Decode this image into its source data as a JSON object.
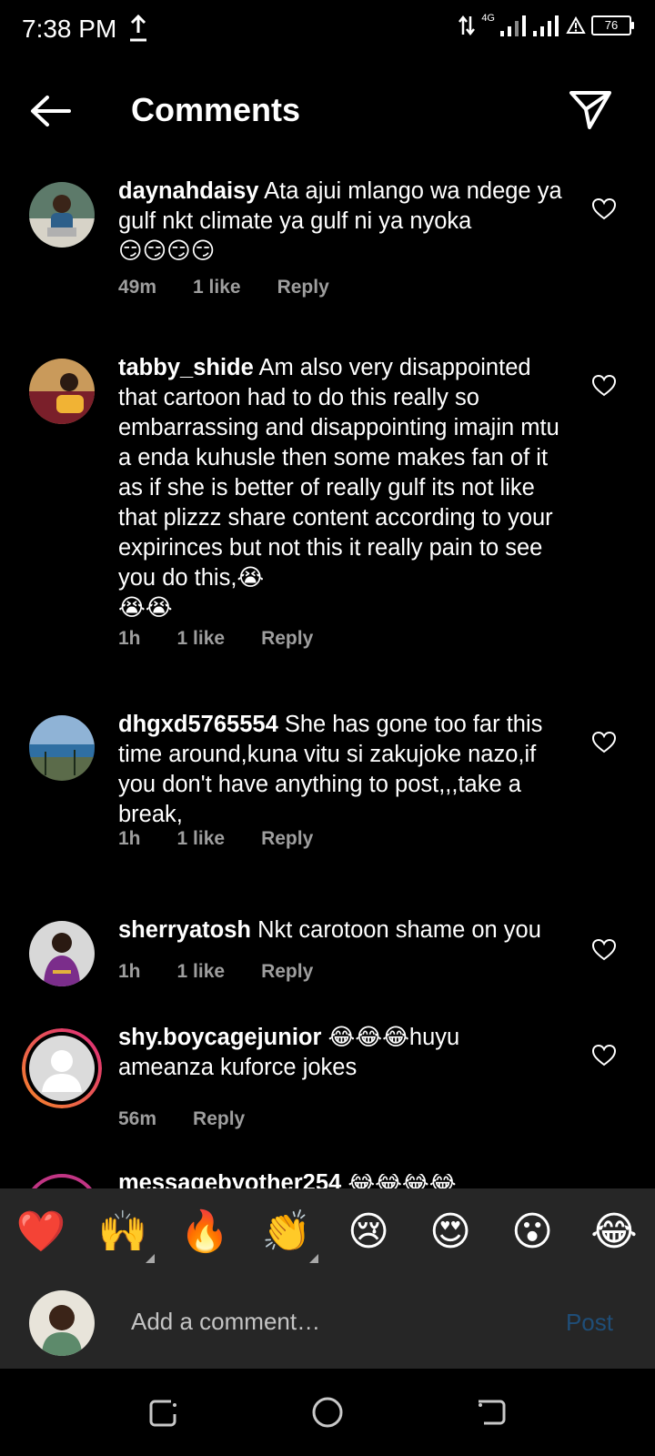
{
  "status_bar": {
    "time": "7:38 PM",
    "network": "4G",
    "battery": "76",
    "icons": [
      "upload-icon",
      "data-arrows-icon",
      "signal-icon",
      "signal-icon",
      "alert-icon",
      "battery-icon"
    ]
  },
  "header": {
    "title": "Comments",
    "back_icon": "arrow-left-icon",
    "send_icon": "paper-plane-icon"
  },
  "comments": [
    {
      "username": "daynahdaisy",
      "text": " Ata ajui mlango wa ndege ya gulf nkt climate ya gulf ni ya nyoka",
      "emoji": "😏😏😏😏",
      "time": "49m",
      "likes": "1 like",
      "reply": "Reply"
    },
    {
      "username": "tabby_shide",
      "text": " Am also very disappointed that cartoon had to do this really so embarrassing and disappointing imajin mtu a enda kuhusle then some makes fan of it as if she is better of really gulf its not like that plizzz share content according to your expirinces but not this it really pain to see you do this,😭",
      "emoji": "😭😭",
      "time": "1h",
      "likes": "1 like",
      "reply": "Reply"
    },
    {
      "username": "dhgxd5765554",
      "text": " She has gone too far this time around,kuna vitu  si zakujoke nazo,if you don't have anything to post,,,take a break,",
      "emoji": "",
      "time": "1h",
      "likes": "1 like",
      "reply": "Reply"
    },
    {
      "username": "sherryatosh",
      "text": " Nkt carotoon shame on you",
      "emoji": "",
      "time": "1h",
      "likes": "1 like",
      "reply": "Reply"
    },
    {
      "username": "shy.boycagejunior",
      "text": " 😂😂😂huyu ameanza kuforce jokes",
      "emoji": "",
      "time": "56m",
      "likes": "",
      "reply": "Reply"
    }
  ],
  "partial_comment": {
    "username": "messagebyother254",
    "emoji": "😂😂😂😂"
  },
  "emoji_tray": [
    "❤️",
    "🙌",
    "🔥",
    "👏",
    "😢",
    "😍",
    "😮",
    "😂"
  ],
  "composer": {
    "placeholder": "Add a comment…",
    "post_label": "Post"
  },
  "nav_bar": {
    "icons": [
      "recent-apps-icon",
      "home-icon",
      "back-icon"
    ]
  },
  "colors": {
    "background": "#000000",
    "tray": "#262626",
    "meta_text": "#9e9e9e",
    "post_disabled": "#1f4e78",
    "story_ring_start": "#f58529",
    "story_ring_end": "#dd2a7b"
  }
}
